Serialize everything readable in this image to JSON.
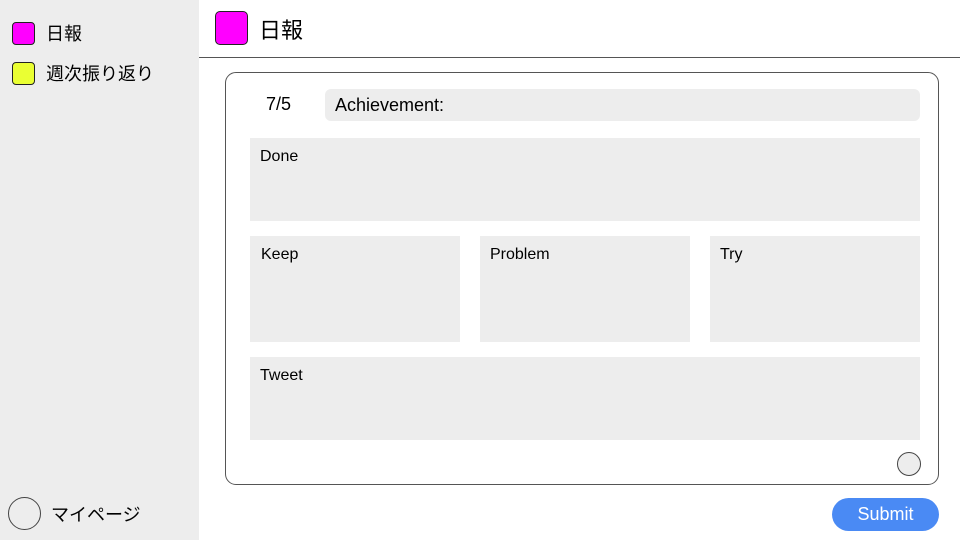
{
  "colors": {
    "nippo_swatch": "#ff00ff",
    "weekly_swatch": "#eaff33",
    "sidebar_bg": "#ededed",
    "field_bg": "#ededed",
    "submit_bg": "#4a8af4"
  },
  "sidebar": {
    "items": [
      {
        "label": "日報",
        "color": "#ff00ff"
      },
      {
        "label": "週次振り返り",
        "color": "#eaff33"
      }
    ],
    "mypage_label": "マイページ"
  },
  "header": {
    "title": "日報",
    "color": "#ff00ff"
  },
  "form": {
    "date": "7/5",
    "achievement_label": "Achievement:",
    "done_label": "Done",
    "keep_label": "Keep",
    "problem_label": "Problem",
    "try_label": "Try",
    "tweet_label": "Tweet",
    "submit_label": "Submit"
  }
}
